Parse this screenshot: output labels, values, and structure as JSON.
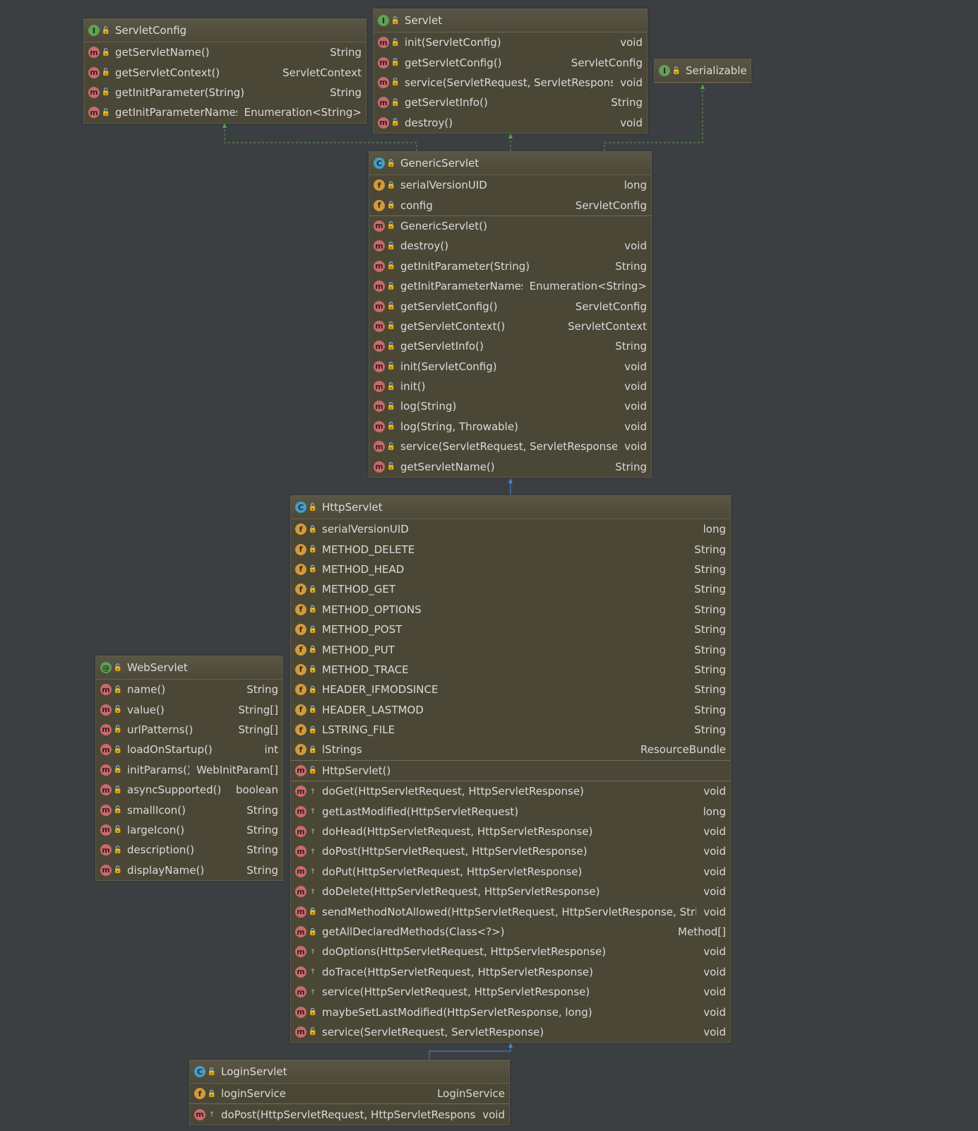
{
  "boxes": [
    {
      "id": "servletconfig",
      "kind": "interface",
      "kind_icon": "I",
      "title": "ServletConfig",
      "sections": [
        [
          {
            "icon": "m",
            "vis": "pub",
            "name": "getServletName()",
            "type": "String"
          },
          {
            "icon": "m",
            "vis": "pub",
            "name": "getServletContext()",
            "type": "ServletContext"
          },
          {
            "icon": "m",
            "vis": "pub",
            "name": "getInitParameter(String)",
            "type": "String"
          },
          {
            "icon": "m",
            "vis": "pub",
            "name": "getInitParameterNames()",
            "type": "Enumeration<String>"
          }
        ]
      ]
    },
    {
      "id": "servlet",
      "kind": "interface",
      "kind_icon": "I",
      "title": "Servlet",
      "sections": [
        [
          {
            "icon": "m",
            "vis": "pub",
            "name": "init(ServletConfig)",
            "type": "void"
          },
          {
            "icon": "m",
            "vis": "pub",
            "name": "getServletConfig()",
            "type": "ServletConfig"
          },
          {
            "icon": "m",
            "vis": "pub",
            "name": "service(ServletRequest, ServletResponse)",
            "type": "void"
          },
          {
            "icon": "m",
            "vis": "pub",
            "name": "getServletInfo()",
            "type": "String"
          },
          {
            "icon": "m",
            "vis": "pub",
            "name": "destroy()",
            "type": "void"
          }
        ]
      ]
    },
    {
      "id": "serializable",
      "kind": "interface",
      "kind_icon": "I",
      "title": "Serializable",
      "sections": []
    },
    {
      "id": "genericservlet",
      "kind": "abstract-class",
      "kind_icon": "C",
      "title": "GenericServlet",
      "sections": [
        [
          {
            "icon": "f",
            "vis": "priv",
            "name": "serialVersionUID",
            "type": "long"
          },
          {
            "icon": "f",
            "vis": "priv",
            "name": "config",
            "type": "ServletConfig"
          }
        ],
        [
          {
            "icon": "m",
            "vis": "pub",
            "name": "GenericServlet()",
            "type": ""
          },
          {
            "icon": "m",
            "vis": "pub",
            "name": "destroy()",
            "type": "void"
          },
          {
            "icon": "m",
            "vis": "pub",
            "name": "getInitParameter(String)",
            "type": "String"
          },
          {
            "icon": "m",
            "vis": "pub",
            "name": "getInitParameterNames()",
            "type": "Enumeration<String>"
          },
          {
            "icon": "m",
            "vis": "pub",
            "name": "getServletConfig()",
            "type": "ServletConfig"
          },
          {
            "icon": "m",
            "vis": "pub",
            "name": "getServletContext()",
            "type": "ServletContext"
          },
          {
            "icon": "m",
            "vis": "pub",
            "name": "getServletInfo()",
            "type": "String"
          },
          {
            "icon": "m",
            "vis": "pub",
            "name": "init(ServletConfig)",
            "type": "void"
          },
          {
            "icon": "m",
            "vis": "pub",
            "name": "init()",
            "type": "void"
          },
          {
            "icon": "m",
            "vis": "pub",
            "name": "log(String)",
            "type": "void"
          },
          {
            "icon": "m",
            "vis": "pub",
            "name": "log(String, Throwable)",
            "type": "void"
          },
          {
            "icon": "m",
            "vis": "pub",
            "name": "service(ServletRequest, ServletResponse)",
            "type": "void"
          },
          {
            "icon": "m",
            "vis": "pub",
            "name": "getServletName()",
            "type": "String"
          }
        ]
      ]
    },
    {
      "id": "httpservlet",
      "kind": "abstract-class",
      "kind_icon": "C",
      "title": "HttpServlet",
      "sections": [
        [
          {
            "icon": "f",
            "vis": "priv",
            "name": "serialVersionUID",
            "type": "long"
          },
          {
            "icon": "f",
            "vis": "priv",
            "name": "METHOD_DELETE",
            "type": "String"
          },
          {
            "icon": "f",
            "vis": "priv",
            "name": "METHOD_HEAD",
            "type": "String"
          },
          {
            "icon": "f",
            "vis": "priv",
            "name": "METHOD_GET",
            "type": "String"
          },
          {
            "icon": "f",
            "vis": "priv",
            "name": "METHOD_OPTIONS",
            "type": "String"
          },
          {
            "icon": "f",
            "vis": "priv",
            "name": "METHOD_POST",
            "type": "String"
          },
          {
            "icon": "f",
            "vis": "priv",
            "name": "METHOD_PUT",
            "type": "String"
          },
          {
            "icon": "f",
            "vis": "priv",
            "name": "METHOD_TRACE",
            "type": "String"
          },
          {
            "icon": "f",
            "vis": "priv",
            "name": "HEADER_IFMODSINCE",
            "type": "String"
          },
          {
            "icon": "f",
            "vis": "priv",
            "name": "HEADER_LASTMOD",
            "type": "String"
          },
          {
            "icon": "f",
            "vis": "priv",
            "name": "LSTRING_FILE",
            "type": "String"
          },
          {
            "icon": "f",
            "vis": "priv",
            "name": "lStrings",
            "type": "ResourceBundle"
          }
        ],
        [
          {
            "icon": "m",
            "vis": "pub",
            "name": "HttpServlet()",
            "type": ""
          }
        ],
        [
          {
            "icon": "m",
            "vis": "prot",
            "name": "doGet(HttpServletRequest, HttpServletResponse)",
            "type": "void"
          },
          {
            "icon": "m",
            "vis": "prot",
            "name": "getLastModified(HttpServletRequest)",
            "type": "long"
          },
          {
            "icon": "m",
            "vis": "prot",
            "name": "doHead(HttpServletRequest, HttpServletResponse)",
            "type": "void"
          },
          {
            "icon": "m",
            "vis": "prot",
            "name": "doPost(HttpServletRequest, HttpServletResponse)",
            "type": "void"
          },
          {
            "icon": "m",
            "vis": "prot",
            "name": "doPut(HttpServletRequest, HttpServletResponse)",
            "type": "void"
          },
          {
            "icon": "m",
            "vis": "prot",
            "name": "doDelete(HttpServletRequest, HttpServletResponse)",
            "type": "void"
          },
          {
            "icon": "m",
            "vis": "priv",
            "name": "sendMethodNotAllowed(HttpServletRequest, HttpServletResponse, String)",
            "type": "void"
          },
          {
            "icon": "m",
            "vis": "priv",
            "name": "getAllDeclaredMethods(Class<?>)",
            "type": "Method[]"
          },
          {
            "icon": "m",
            "vis": "prot",
            "name": "doOptions(HttpServletRequest, HttpServletResponse)",
            "type": "void"
          },
          {
            "icon": "m",
            "vis": "prot",
            "name": "doTrace(HttpServletRequest, HttpServletResponse)",
            "type": "void"
          },
          {
            "icon": "m",
            "vis": "prot",
            "name": "service(HttpServletRequest, HttpServletResponse)",
            "type": "void"
          },
          {
            "icon": "m",
            "vis": "priv",
            "name": "maybeSetLastModified(HttpServletResponse, long)",
            "type": "void"
          },
          {
            "icon": "m",
            "vis": "pub",
            "name": "service(ServletRequest, ServletResponse)",
            "type": "void"
          }
        ]
      ]
    },
    {
      "id": "webservlet",
      "kind": "annotation",
      "kind_icon": "@",
      "title": "WebServlet",
      "sections": [
        [
          {
            "icon": "m",
            "vis": "pub",
            "name": "name()",
            "type": "String"
          },
          {
            "icon": "m",
            "vis": "pub",
            "name": "value()",
            "type": "String[]"
          },
          {
            "icon": "m",
            "vis": "pub",
            "name": "urlPatterns()",
            "type": "String[]"
          },
          {
            "icon": "m",
            "vis": "pub",
            "name": "loadOnStartup()",
            "type": "int"
          },
          {
            "icon": "m",
            "vis": "pub",
            "name": "initParams()",
            "type": "WebInitParam[]"
          },
          {
            "icon": "m",
            "vis": "pub",
            "name": "asyncSupported()",
            "type": "boolean"
          },
          {
            "icon": "m",
            "vis": "pub",
            "name": "smallIcon()",
            "type": "String"
          },
          {
            "icon": "m",
            "vis": "pub",
            "name": "largeIcon()",
            "type": "String"
          },
          {
            "icon": "m",
            "vis": "pub",
            "name": "description()",
            "type": "String"
          },
          {
            "icon": "m",
            "vis": "pub",
            "name": "displayName()",
            "type": "String"
          }
        ]
      ]
    },
    {
      "id": "loginservlet",
      "kind": "class",
      "kind_icon": "C",
      "title": "LoginServlet",
      "sections": [
        [
          {
            "icon": "f",
            "vis": "priv",
            "name": "loginService",
            "type": "LoginService"
          }
        ],
        [
          {
            "icon": "m",
            "vis": "prot",
            "name": "doPost(HttpServletRequest, HttpServletResponse)",
            "type": "void"
          }
        ]
      ]
    }
  ],
  "edges": [
    {
      "from": "genericservlet",
      "to": "servletconfig",
      "kind": "implements"
    },
    {
      "from": "genericservlet",
      "to": "servlet",
      "kind": "implements"
    },
    {
      "from": "genericservlet",
      "to": "serializable",
      "kind": "implements"
    },
    {
      "from": "httpservlet",
      "to": "genericservlet",
      "kind": "extends"
    },
    {
      "from": "loginservlet",
      "to": "httpservlet",
      "kind": "extends"
    }
  ],
  "colors": {
    "implements": "#5f9e55",
    "extends": "#4e86c8"
  }
}
